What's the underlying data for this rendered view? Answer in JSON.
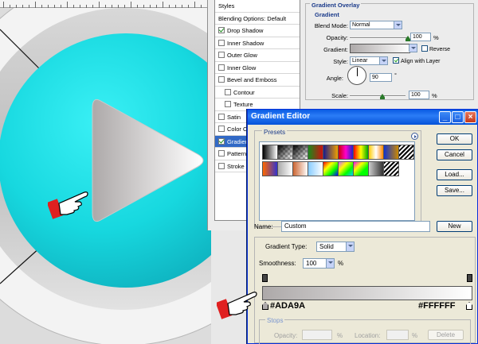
{
  "layer_style": {
    "styles_list": [
      {
        "label": "Styles",
        "kind": "header"
      },
      {
        "label": "Blending Options: Default",
        "kind": "header"
      },
      {
        "label": "Drop Shadow",
        "checked": true
      },
      {
        "label": "Inner Shadow",
        "checked": false
      },
      {
        "label": "Outer Glow",
        "checked": false
      },
      {
        "label": "Inner Glow",
        "checked": false
      },
      {
        "label": "Bevel and Emboss",
        "checked": false
      },
      {
        "label": "Contour",
        "checked": false,
        "indent": true
      },
      {
        "label": "Texture",
        "checked": false,
        "indent": true
      },
      {
        "label": "Satin",
        "checked": false
      },
      {
        "label": "Color Overlay",
        "checked": false
      },
      {
        "label": "Gradient Overlay",
        "checked": true,
        "selected": true
      },
      {
        "label": "Pattern Overlay",
        "checked": false
      },
      {
        "label": "Stroke",
        "checked": false
      }
    ],
    "gradient_overlay": {
      "title": "Gradient Overlay",
      "subtitle": "Gradient",
      "blend_mode_label": "Blend Mode:",
      "blend_mode_value": "Normal",
      "opacity_label": "Opacity:",
      "opacity_value": "100",
      "opacity_unit": "%",
      "gradient_label": "Gradient:",
      "reverse_label": "Reverse",
      "reverse_checked": false,
      "style_label": "Style:",
      "style_value": "Linear",
      "align_label": "Align with Layer",
      "align_checked": true,
      "angle_label": "Angle:",
      "angle_value": "90",
      "angle_unit": "°",
      "scale_label": "Scale:",
      "scale_value": "100",
      "scale_unit": "%"
    }
  },
  "gradient_editor": {
    "title": "Gradient Editor",
    "window_buttons": {
      "minimize": "_",
      "maximize": "□",
      "close": "×"
    },
    "presets_label": "Presets",
    "preset_swatches": [
      {
        "from": "#000000",
        "to": "#ffffff"
      },
      {
        "from": "#000000",
        "to": "#ffffff",
        "checker": true
      },
      {
        "from": "#000000",
        "to": "#ffffff",
        "checker": true
      },
      {
        "from": "#1a8a1a",
        "to": "#cc1111"
      },
      {
        "from": "#1a1a8a",
        "to": "#f0a000"
      },
      {
        "from": "#cc0000",
        "to": "#2222cc",
        "mid": "#ff00cc"
      },
      {
        "from": "#ff0000",
        "to": "#00aa00",
        "mid": "#ffff00"
      },
      {
        "from": "#ffcc00",
        "to": "#ff8800",
        "mid": "#ffffff"
      },
      {
        "from": "#1133cc",
        "to": "#cc8800"
      },
      {
        "from": "#000000",
        "to": "#ffffff",
        "stripes": true
      },
      {
        "from": "#ff6600",
        "to": "#3333cc"
      },
      {
        "from": "#aaaaaa",
        "to": "#ffffff"
      },
      {
        "from": "#cc6633",
        "to": "#ffffff"
      },
      {
        "from": "#88ccff",
        "to": "#ffffff"
      },
      {
        "from": "#ff0000",
        "to": "#0000ff",
        "rainbow": true
      },
      {
        "from": "#cc66ff",
        "to": "#00ccff",
        "rainbow": true
      },
      {
        "from": "#ff00ff",
        "to": "#00ff00",
        "rainbow": true
      },
      {
        "from": "#cccccc",
        "to": "#333333"
      },
      {
        "from": "#000000",
        "to": "#ffffff",
        "stripes": true
      }
    ],
    "buttons": {
      "ok": "OK",
      "cancel": "Cancel",
      "load": "Load...",
      "save": "Save...",
      "new": "New"
    },
    "name_label": "Name:",
    "name_value": "Custom",
    "gradient_type_label": "Gradient Type:",
    "gradient_type_value": "Solid",
    "smoothness_label": "Smoothness:",
    "smoothness_value": "100",
    "smoothness_unit": "%",
    "color_left": "#ADA9A9",
    "color_right": "#FFFFFF",
    "color_left_label": "#ADA9A",
    "color_right_label": "#FFFFFF",
    "stops": {
      "label": "Stops",
      "opacity_label": "Opacity:",
      "opacity_unit": "%",
      "location_label": "Location:",
      "location_unit": "%",
      "delete_label": "Delete"
    }
  },
  "colors": {
    "play_circle": "#19d9e0",
    "ring": "#c8c8c8",
    "hand_pointer": "#e02020",
    "dialog_title": "#0a5be3"
  }
}
